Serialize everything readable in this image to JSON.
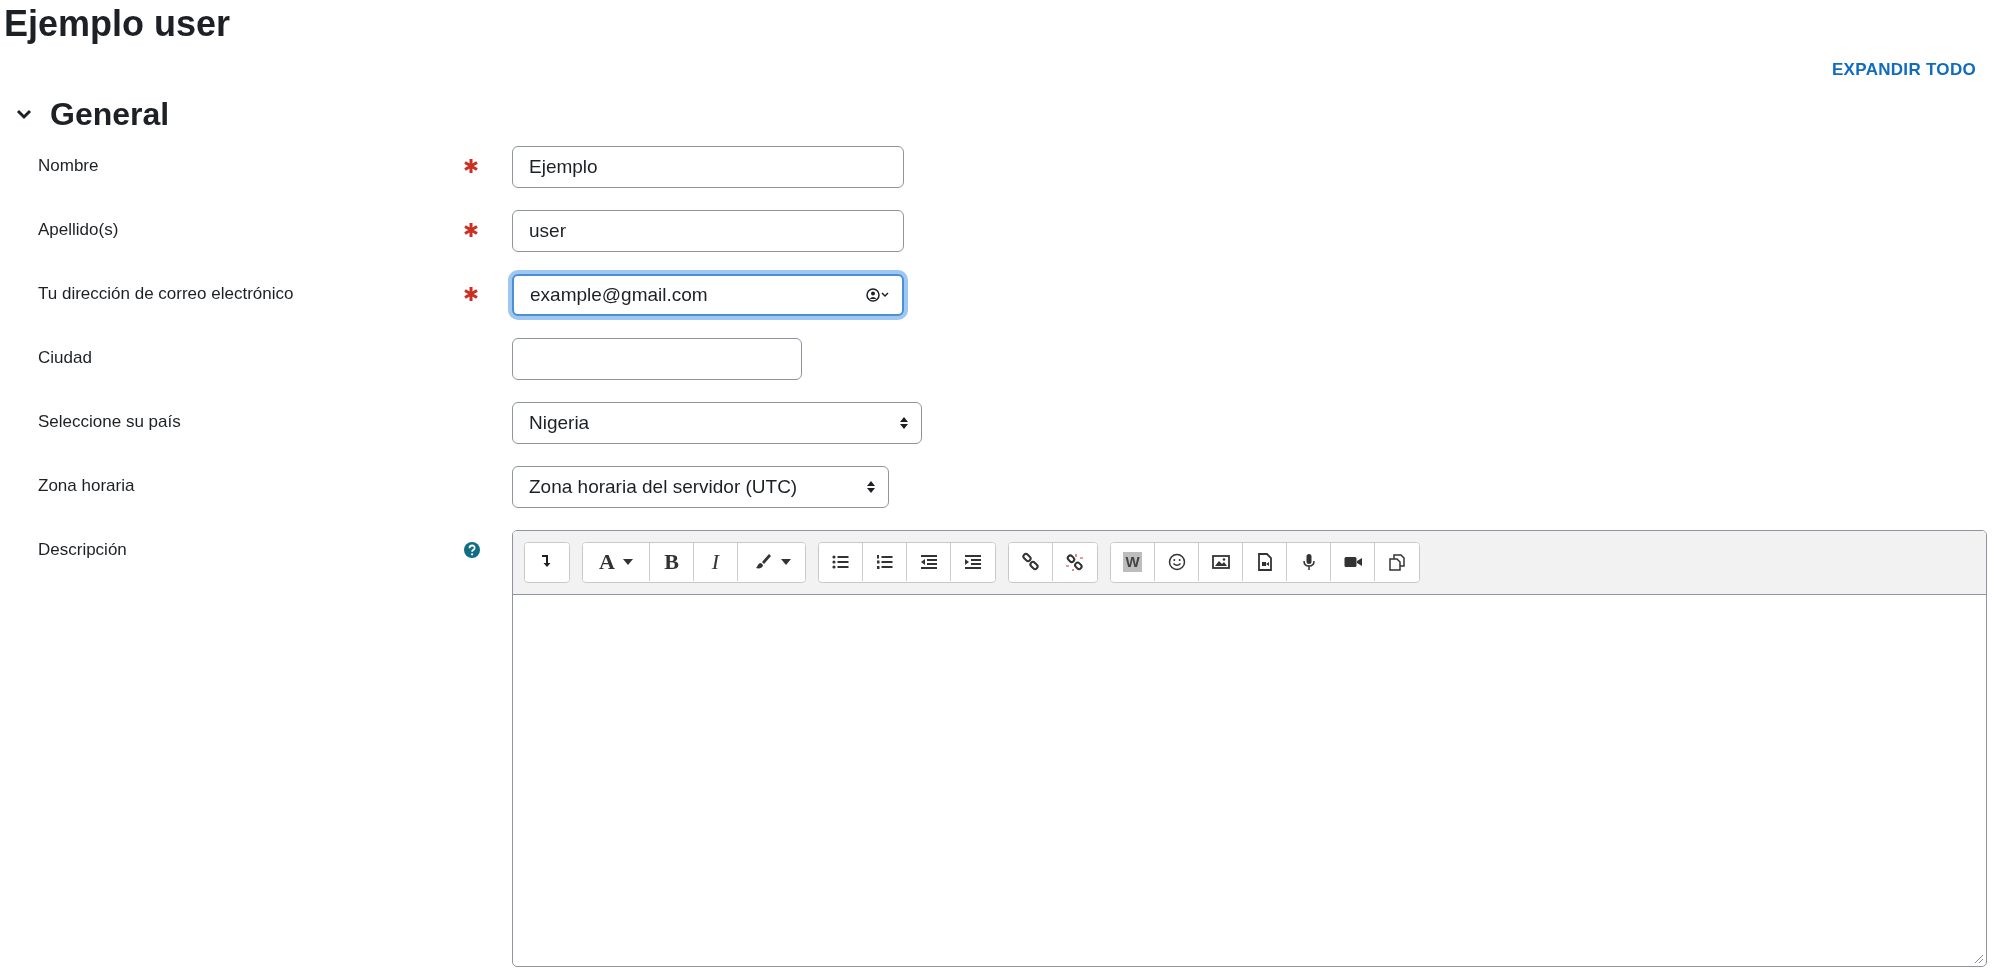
{
  "page_title": "Ejemplo user",
  "expand_all": "EXPANDIR TODO",
  "section": {
    "title": "General",
    "expanded": true
  },
  "fields": [
    {
      "label": "Nombre",
      "required": true,
      "help": false,
      "kind": "text",
      "value": "Ejemplo",
      "focused": false
    },
    {
      "label": "Apellido(s)",
      "required": true,
      "help": false,
      "kind": "text",
      "value": "user",
      "focused": false
    },
    {
      "label": "Tu dirección de correo electrónico",
      "required": true,
      "help": false,
      "kind": "email",
      "value": "example@gmail.com",
      "focused": true
    },
    {
      "label": "Ciudad",
      "required": false,
      "help": false,
      "kind": "text",
      "focused": false
    },
    {
      "label": "Seleccione su país",
      "required": false,
      "help": false,
      "kind": "select",
      "value": "Nigeria",
      "focused": false
    },
    {
      "label": "Zona horaria",
      "required": false,
      "help": false,
      "kind": "select",
      "value": "Zona horaria del servidor (UTC)",
      "focused": false
    },
    {
      "label": "Descripción",
      "required": false,
      "help": true,
      "kind": "editor",
      "focused": false
    }
  ],
  "toolbar": [
    [
      {
        "kind": "collapse"
      }
    ],
    [
      {
        "kind": "font",
        "label": "A",
        "menu": true
      },
      {
        "kind": "bold",
        "label": "B"
      },
      {
        "kind": "italic",
        "label": "I"
      },
      {
        "kind": "brush",
        "menu": true
      }
    ],
    [
      {
        "kind": "bullets"
      },
      {
        "kind": "numbers"
      },
      {
        "kind": "outdent"
      },
      {
        "kind": "indent"
      }
    ],
    [
      {
        "kind": "link"
      },
      {
        "kind": "unlink"
      }
    ],
    [
      {
        "kind": "word",
        "label": "W"
      },
      {
        "kind": "emoji"
      },
      {
        "kind": "image"
      },
      {
        "kind": "media"
      },
      {
        "kind": "mic"
      },
      {
        "kind": "video"
      },
      {
        "kind": "paste"
      }
    ]
  ]
}
